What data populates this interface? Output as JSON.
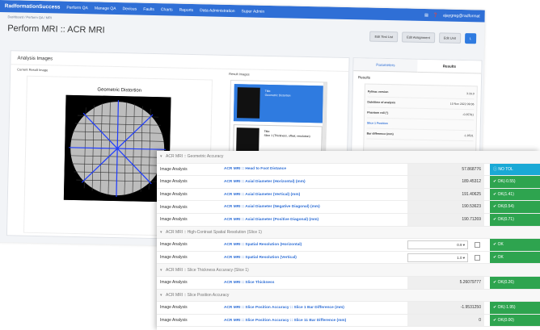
{
  "nav": {
    "brand": "RadformationSuccess",
    "items": [
      "Perform QA",
      "Manage QA",
      "Devices",
      "Faults",
      "Charts",
      "Reports",
      "Data Administration",
      "Super Admin"
    ],
    "user": "ajaygreg@radformat"
  },
  "breadcrumb": "Dashboard / Perform QA / MRI",
  "page": {
    "title": "Perform MRI :: ACR MRI",
    "buttons": {
      "edit_test_list": "Edit Test List",
      "edit_assignment": "Edit Assignment",
      "edit_unit": "Edit Unit",
      "truncated": "L"
    }
  },
  "analysis": {
    "title": "Analysis Images",
    "current_label": "Current Result Image",
    "results_label": "Result Images",
    "image_caption": "Geometric Distortion",
    "thumbs": [
      {
        "title": "Title:",
        "desc": "Geometric Distortion"
      },
      {
        "title": "Title:",
        "desc": "Slice 1 (Thickness, offset, resolution)"
      }
    ]
  },
  "right_panel": {
    "tabs": [
      "Parameters",
      "Results"
    ],
    "heading": "Results",
    "rows": [
      {
        "k": "Pylinac version",
        "v": "3.16.0"
      },
      {
        "k": "Date/time of analysis",
        "v": "10 Nov 2022 09:36"
      },
      {
        "k": "Phantom roll (°)",
        "v": "-0.35761"
      },
      {
        "k": "Slice 1 Position",
        "v": ""
      },
      {
        "k": "Bar difference (mm)",
        "v": "-1.9531"
      }
    ]
  },
  "table": {
    "rows": [
      {
        "kind": "section",
        "title": "ACR MRI :: Geometric Accuracy"
      },
      {
        "kind": "data",
        "type": "Image Analysis",
        "name": "ACR MRI :: Head to Foot Distance",
        "value": "57.868776",
        "status": "NO TOL",
        "status_kind": "notol"
      },
      {
        "kind": "data",
        "type": "Image Analysis",
        "name": "ACR MRI :: Axial Diameter (Horizontal) (mm)",
        "value": "189.45312",
        "status": "OK(-0.55)",
        "status_kind": "ok"
      },
      {
        "kind": "data",
        "type": "Image Analysis",
        "name": "ACR MRI :: Axial Diameter (Vertical) (mm)",
        "value": "191.40625",
        "status": "OK(1.41)",
        "status_kind": "ok"
      },
      {
        "kind": "data",
        "type": "Image Analysis",
        "name": "ACR MRI :: Axial Diameter (Negative Diagonal) (mm)",
        "value": "190.53623",
        "status": "OK(0.54)",
        "status_kind": "ok"
      },
      {
        "kind": "data",
        "type": "Image Analysis",
        "name": "ACR MRI :: Axial Diameter (Positive Diagonal) (mm)",
        "value": "190.71269",
        "status": "OK(0.71)",
        "status_kind": "ok"
      },
      {
        "kind": "section",
        "title": "ACR MRI :: High-Contrast Spatial Resolution (Slice 1)"
      },
      {
        "kind": "select",
        "type": "Image Analysis",
        "name": "ACR MRI :: Spatial Resolution (Horizontal)",
        "value": "0.9",
        "status": "OK",
        "status_kind": "ok"
      },
      {
        "kind": "select",
        "type": "Image Analysis",
        "name": "ACR MRI :: Spatial Resolution (Vertical)",
        "value": "1.0",
        "status": "OK",
        "status_kind": "ok"
      },
      {
        "kind": "section",
        "title": "ACR MRI :: Slice Thickness Accuracy (Slice 1)"
      },
      {
        "kind": "data",
        "type": "Image Analysis",
        "name": "ACR MRI :: Slice Thickness",
        "value": "5.26079777",
        "status": "OK(0.26)",
        "status_kind": "ok"
      },
      {
        "kind": "section",
        "title": "ACR MRI :: Slice Position Accuracy"
      },
      {
        "kind": "data",
        "type": "Image Analysis",
        "name": "ACR MRI :: Slice Position Accuracy :: Slice 1 Bar Difference (mm)",
        "value": "-1.9531250",
        "status": "OK(-1.95)",
        "status_kind": "ok"
      },
      {
        "kind": "data",
        "type": "Image Analysis",
        "name": "ACR MRI :: Slice Position Accuracy :: Slice 11 Bar Difference (mm)",
        "value": "0",
        "status": "OK(0.00)",
        "status_kind": "ok"
      }
    ]
  },
  "icons": {
    "section_chevron": "chevron-down-icon",
    "select_caret": "caret-down-icon",
    "status_ok": "check-circle-icon",
    "status_notol": "info-circle-icon"
  },
  "colors": {
    "nav": "#2f6fd6",
    "ok": "#2ea44f",
    "notol": "#1aa9d6",
    "link": "#2f6fd6"
  }
}
